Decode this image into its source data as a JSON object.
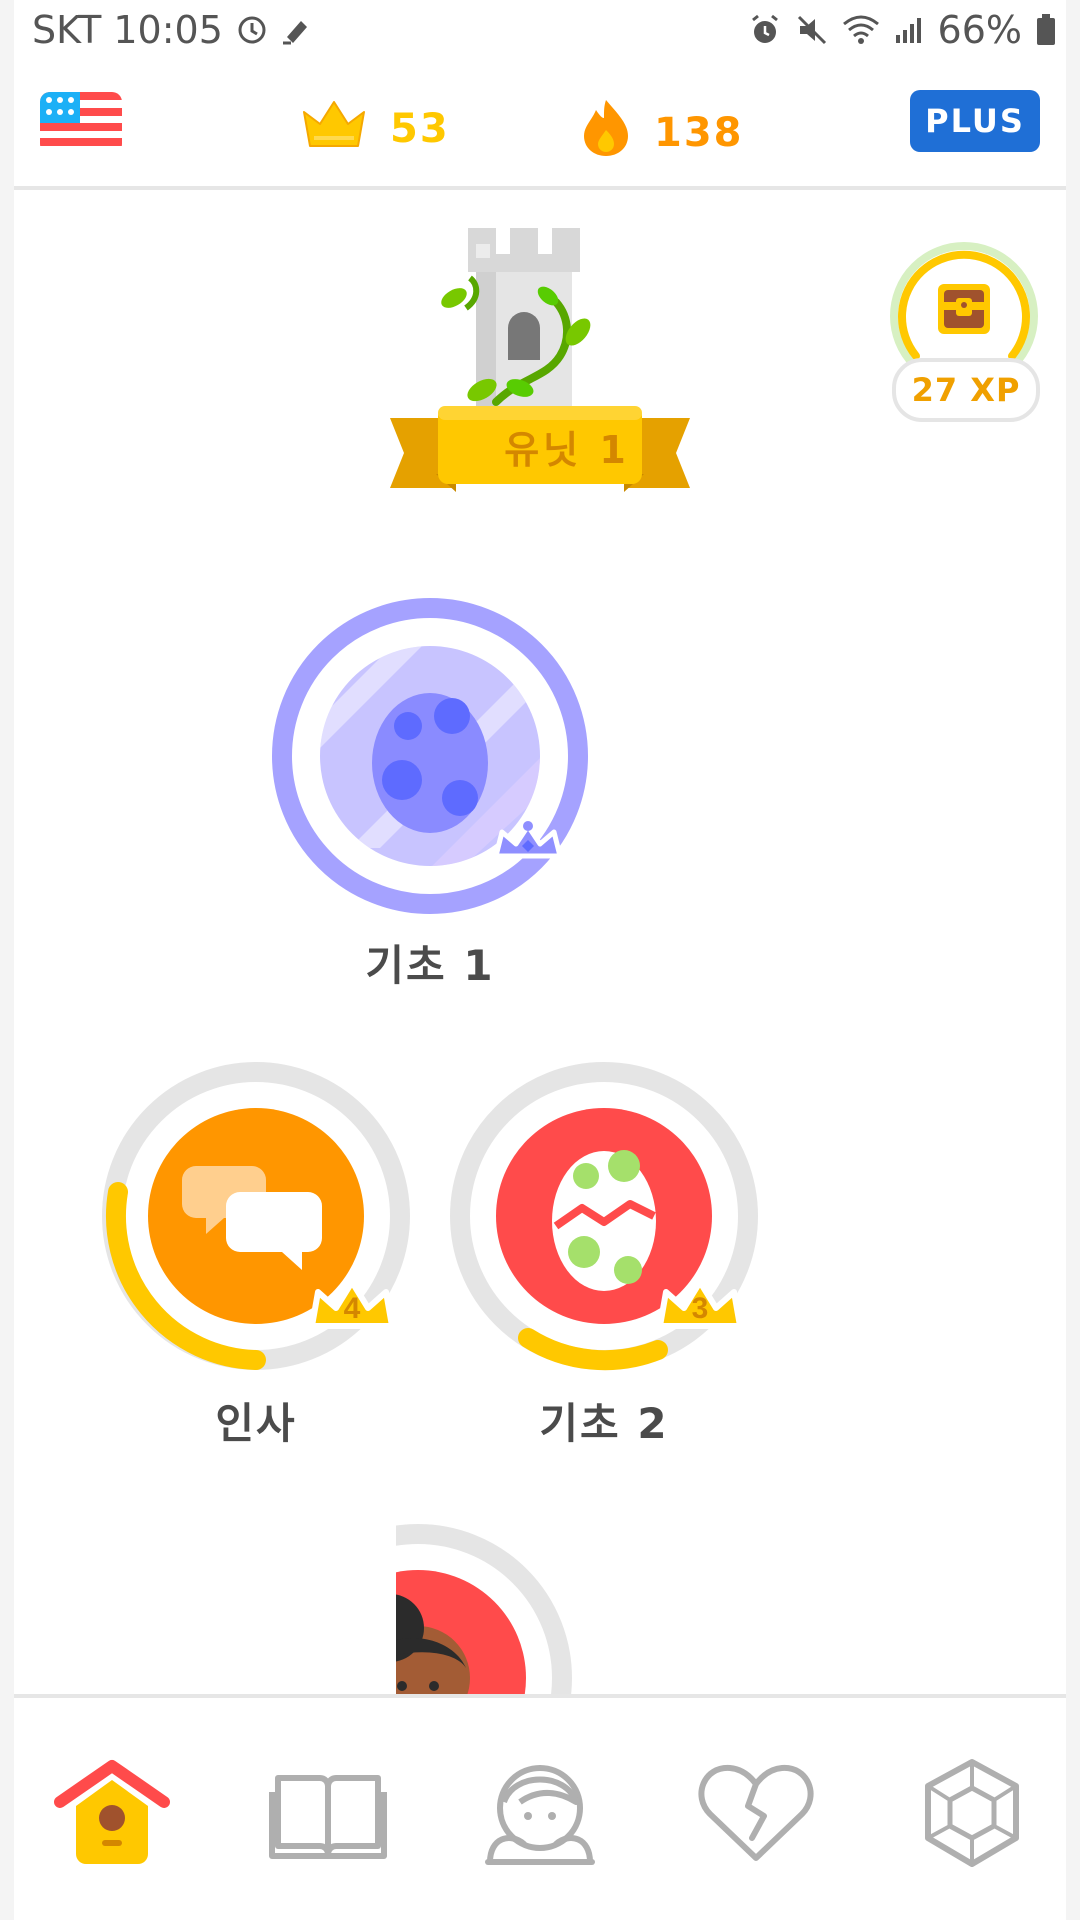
{
  "status_bar": {
    "carrier_time": "SKT 10:05",
    "battery": "66%",
    "icons": [
      "clock-icon",
      "edit-icon",
      "alarm-icon",
      "mute-icon",
      "wifi-icon",
      "signal-icon",
      "battery-icon"
    ]
  },
  "header": {
    "language_flag": "us-flag-icon",
    "crowns_count": "53",
    "streak_count": "138",
    "plus_label": "PLUS",
    "colors": {
      "crown": "#ffc800",
      "streak": "#ff9600",
      "plus": "#1f6fd6"
    }
  },
  "unit": {
    "label": "유닛 1"
  },
  "xp_chest": {
    "label": "27 XP"
  },
  "skills": [
    {
      "label": "기초 1",
      "icon": "egg-icon",
      "color": "#a5a2ff"
    },
    {
      "label": "인사",
      "icon": "chat-bubbles-icon",
      "color": "#ff9600",
      "level": "4",
      "progress": 0.4
    },
    {
      "label": "기초 2",
      "icon": "cracked-egg-icon",
      "color": "#ff4b4b",
      "level": "3",
      "progress": 0.15
    },
    {
      "label": "",
      "icon": "person-icon",
      "color": "#ff4b4b"
    }
  ],
  "bottom_nav": [
    {
      "name": "home",
      "icon": "home-icon",
      "active": true
    },
    {
      "name": "stories",
      "icon": "book-icon",
      "active": false
    },
    {
      "name": "profile",
      "icon": "profile-icon",
      "active": false
    },
    {
      "name": "leagues",
      "icon": "broken-heart-icon",
      "active": false
    },
    {
      "name": "shop",
      "icon": "gem-icon",
      "active": false
    }
  ]
}
